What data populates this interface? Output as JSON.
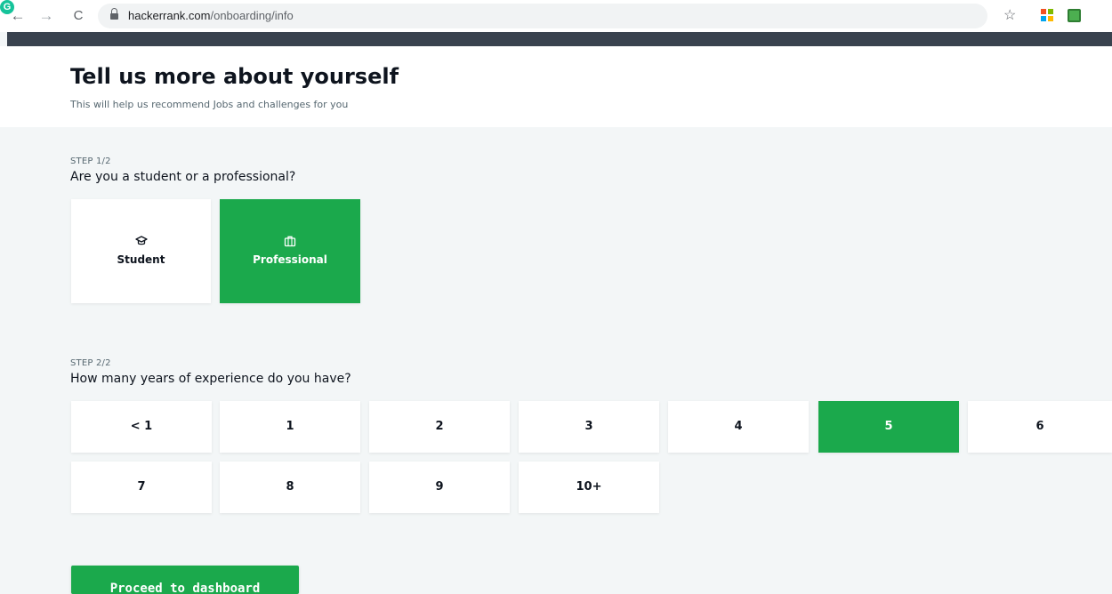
{
  "browser": {
    "url_domain": "hackerrank.com",
    "url_path": "/onboarding/info",
    "back_glyph": "←",
    "forward_glyph": "→",
    "reload_glyph": "C",
    "star_glyph": "☆",
    "grammarly_glyph": "G",
    "extensions": [
      "windows-icon",
      "green-extension-icon",
      "grammarly-icon"
    ]
  },
  "header": {
    "title": "Tell us more about yourself",
    "subtitle": "This will help us recommend Jobs and challenges for you"
  },
  "step1": {
    "label": "STEP 1/2",
    "question": "Are you a student or a professional?",
    "options": [
      {
        "label": "Student",
        "icon": "graduation-cap-icon",
        "selected": false
      },
      {
        "label": "Professional",
        "icon": "briefcase-icon",
        "selected": true
      }
    ]
  },
  "step2": {
    "label": "STEP 2/2",
    "question": "How many years of experience do you have?",
    "options": [
      "< 1",
      "1",
      "2",
      "3",
      "4",
      "5",
      "6",
      "7",
      "8",
      "9",
      "10+"
    ],
    "selected": "5"
  },
  "proceed_label": "Proceed to dashboard",
  "colors": {
    "accent": "#1ba94c",
    "dark_strip": "#39424e",
    "background": "#f3f6f7"
  }
}
